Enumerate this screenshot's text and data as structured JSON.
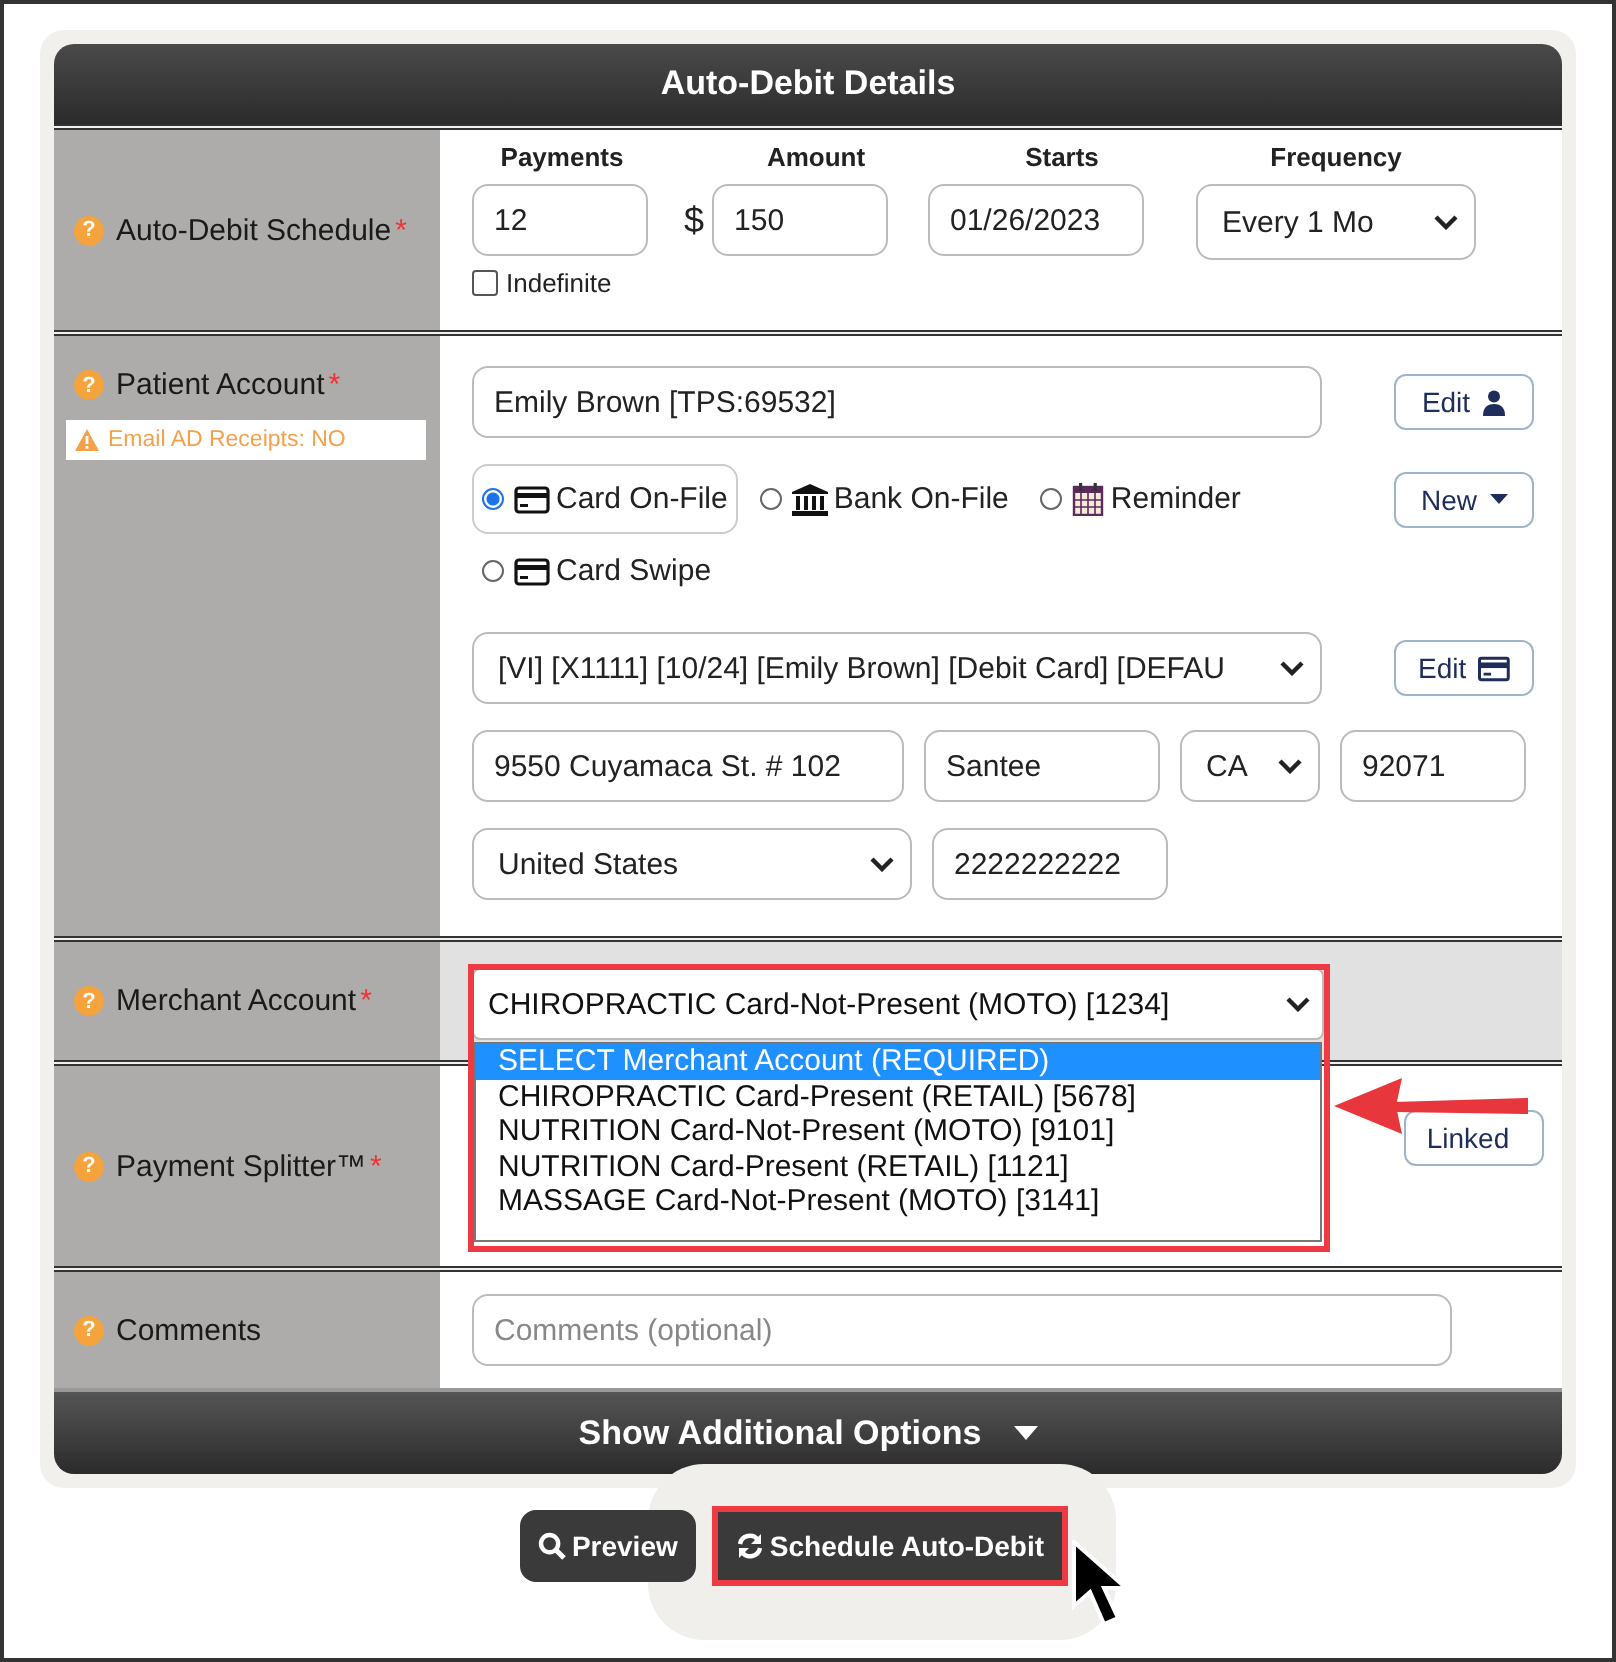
{
  "header": {
    "title": "Auto-Debit Details"
  },
  "help_glyph": "?",
  "required_mark": "*",
  "schedule": {
    "label": "Auto-Debit Schedule",
    "required": true,
    "payments": {
      "heading": "Payments",
      "value": "12"
    },
    "amount": {
      "heading": "Amount",
      "currency": "$",
      "value": "150"
    },
    "starts": {
      "heading": "Starts",
      "value": "01/26/2023"
    },
    "frequency": {
      "heading": "Frequency",
      "value": "Every 1 Mo"
    },
    "indefinite": {
      "label": "Indefinite",
      "checked": false
    }
  },
  "patient": {
    "label": "Patient Account",
    "required": true,
    "warning": "Email AD Receipts: NO",
    "name": "Emily Brown [TPS:69532]",
    "edit_button": "Edit",
    "new_button": "New",
    "methods": [
      {
        "kind": "card",
        "label": "Card On-File",
        "selected": true
      },
      {
        "kind": "bank",
        "label": "Bank On-File",
        "selected": false
      },
      {
        "kind": "reminder",
        "label": "Reminder",
        "selected": false
      },
      {
        "kind": "swipe",
        "label": "Card Swipe",
        "selected": false
      }
    ],
    "card": "[VI] [X1111] [10/24] [Emily Brown] [Debit Card] [DEFAU",
    "card_edit_button": "Edit",
    "address": "9550 Cuyamaca St. # 102",
    "city": "Santee",
    "state": "CA",
    "zip": "92071",
    "country": "United States",
    "phone": "2222222222"
  },
  "merchant": {
    "label": "Merchant Account",
    "required": true,
    "highlighted": true,
    "value": "CHIROPRACTIC Card-Not-Present (MOTO) [1234]",
    "options": [
      {
        "label": "SELECT Merchant Account (REQUIRED)",
        "selected": true
      },
      {
        "label": "CHIROPRACTIC Card-Present (RETAIL) [5678]",
        "selected": false
      },
      {
        "label": "NUTRITION Card-Not-Present (MOTO) [9101]",
        "selected": false
      },
      {
        "label": "NUTRITION Card-Present (RETAIL) [1121]",
        "selected": false
      },
      {
        "label": "MASSAGE Card-Not-Present (MOTO) [3141]",
        "selected": false
      }
    ]
  },
  "splitter": {
    "label": "Payment Splitter™",
    "required": true,
    "button": "Linked"
  },
  "comments": {
    "label": "Comments",
    "required": false,
    "placeholder": "Comments (optional)"
  },
  "footer": {
    "label": "Show Additional Options"
  },
  "actions": [
    {
      "kind": "preview",
      "label": "Preview",
      "highlighted": false
    },
    {
      "kind": "schedule",
      "label": "Schedule Auto-Debit",
      "highlighted": true
    }
  ]
}
